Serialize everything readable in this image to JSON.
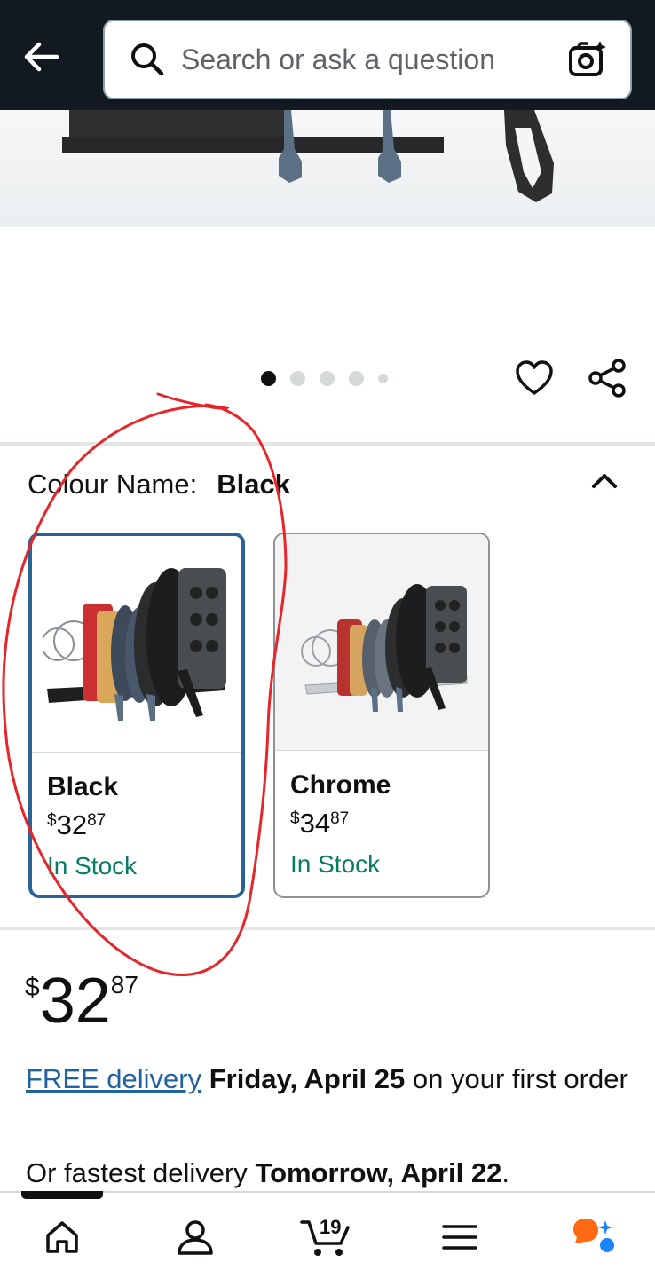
{
  "header": {
    "search_placeholder": "Search or ask a question"
  },
  "carousel": {
    "total": 5,
    "active_index": 0
  },
  "colour": {
    "label": "Colour Name:",
    "selected": "Black"
  },
  "swatches": [
    {
      "name": "Black",
      "price_symbol": "$",
      "price_whole": "32",
      "price_cents": "87",
      "stock": "In Stock",
      "selected": true
    },
    {
      "name": "Chrome",
      "price_symbol": "$",
      "price_whole": "34",
      "price_cents": "87",
      "stock": "In Stock",
      "selected": false
    }
  ],
  "price": {
    "symbol": "$",
    "whole": "32",
    "cents": "87"
  },
  "delivery": {
    "link": "FREE delivery",
    "date": "Friday, April 25",
    "suffix": "on your first order",
    "fastest_prefix": "Or fastest delivery",
    "fastest_date": "Tomorrow, April 22",
    "fastest_end": "."
  },
  "nav": {
    "cart_count": "19"
  },
  "colors": {
    "header_bg": "#131921",
    "selected_border": "#2a6496",
    "in_stock": "#067d62",
    "link": "#2162a1",
    "annotation": "#e5262a"
  },
  "icons": [
    "back-arrow-icon",
    "search-icon",
    "camera-sparkle-icon",
    "heart-icon",
    "share-icon",
    "chevron-up-icon",
    "home-icon",
    "account-icon",
    "cart-icon",
    "menu-icon",
    "rufus-icon"
  ]
}
